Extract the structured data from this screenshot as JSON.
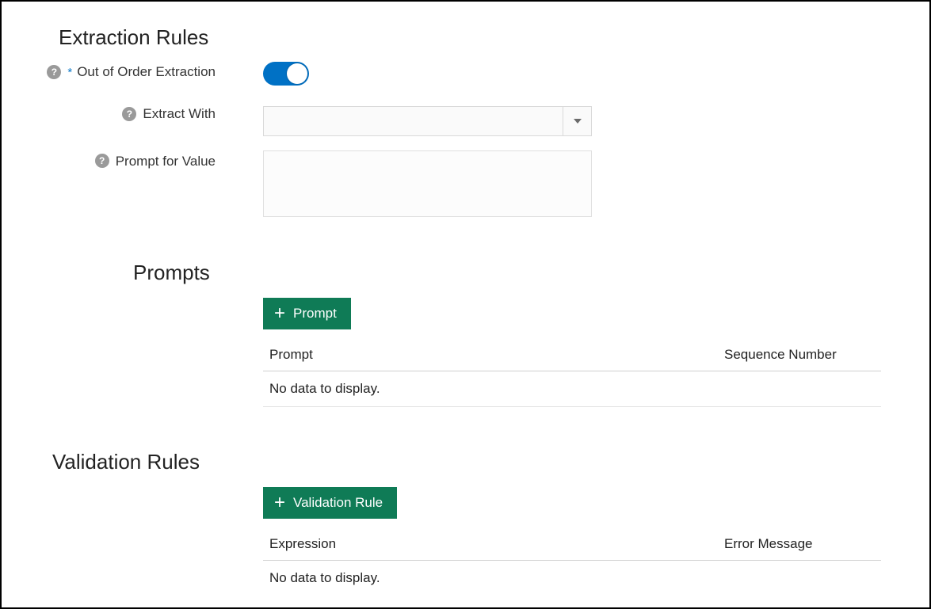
{
  "extraction": {
    "title": "Extraction Rules",
    "fields": {
      "out_of_order": {
        "label": "Out of Order Extraction",
        "required": true,
        "value": true
      },
      "extract_with": {
        "label": "Extract With",
        "value": ""
      },
      "prompt_for_value": {
        "label": "Prompt for Value",
        "value": ""
      }
    }
  },
  "prompts": {
    "title": "Prompts",
    "add_button": "Prompt",
    "columns": {
      "c1": "Prompt",
      "c2": "Sequence Number"
    },
    "empty": "No data to display."
  },
  "validation": {
    "title": "Validation Rules",
    "add_button": "Validation Rule",
    "columns": {
      "c1": "Expression",
      "c2": "Error Message"
    },
    "empty": "No data to display."
  },
  "glyphs": {
    "help": "?",
    "required": "*",
    "plus": "+"
  }
}
